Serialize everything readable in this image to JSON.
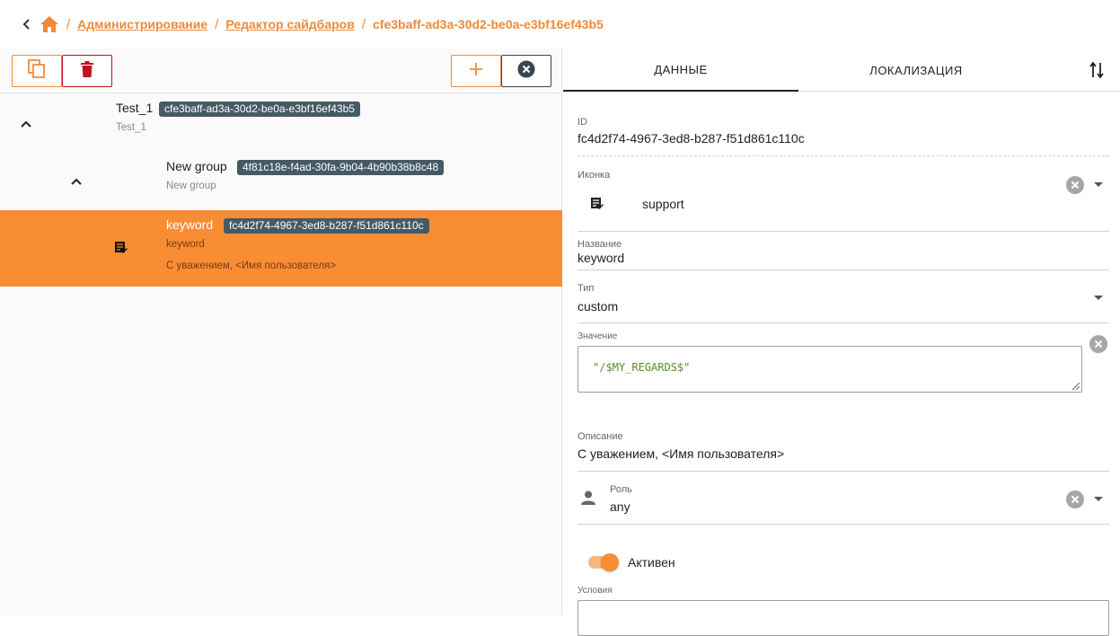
{
  "breadcrumb": {
    "items": [
      "Администрирование",
      "Редактор сайдбаров"
    ],
    "current": "cfe3baff-ad3a-30d2-be0a-e3bf16ef43b5",
    "separator": "/"
  },
  "toolbar": {
    "copy_icon": "copy-icon",
    "delete_icon": "trash-icon",
    "add_icon": "plus-icon",
    "close_icon": "close-circle-icon"
  },
  "tree": [
    {
      "title": "Test_1",
      "id": "cfe3baff-ad3a-30d2-be0a-e3bf16ef43b5",
      "subtitle": "Test_1",
      "expanded": true
    },
    {
      "title": "New group",
      "id": "4f81c18e-f4ad-30fa-9b04-4b90b38b8c48",
      "subtitle": "New group",
      "expanded": true
    },
    {
      "title": "keyword",
      "id": "fc4d2f74-4967-3ed8-b287-f51d861c110c",
      "subtitle": "keyword",
      "description": "С уважением, <Имя пользователя>",
      "selected": true
    }
  ],
  "tabs": [
    "ДАННЫЕ",
    "ЛОКАЛИЗАЦИЯ"
  ],
  "form": {
    "id_label": "ID",
    "id_value": "fc4d2f74-4967-3ed8-b287-f51d861c110c",
    "icon_label": "Иконка",
    "icon_value": "support",
    "name_label": "Название",
    "name_value": "keyword",
    "type_label": "Тип",
    "type_value": "custom",
    "value_label": "Значение",
    "value_value": "\"/$MY_REGARDS$\"",
    "desc_label": "Описание",
    "desc_value": "С уважением, <Имя пользователя>",
    "role_label": "Роль",
    "role_value": "any",
    "active_label": "Активен",
    "active": true,
    "cond_label": "Условия"
  },
  "colors": {
    "accent": "#f98d34",
    "link": "#f08a38",
    "chip": "#455a64",
    "danger": "#c0121f"
  }
}
